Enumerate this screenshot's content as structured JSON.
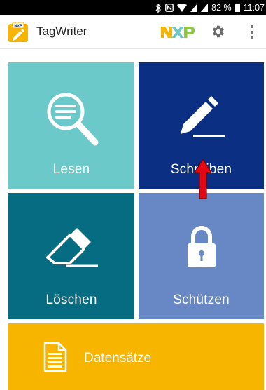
{
  "status_bar": {
    "battery_percent": "82 %",
    "time": "11:07",
    "icons": [
      "bluetooth-icon",
      "nfc-icon",
      "wifi-icon",
      "signal-icon",
      "signal-icon",
      "battery-icon"
    ]
  },
  "app_bar": {
    "title": "TagWriter",
    "logo_text": "NXP",
    "brand_logo": "nxp-logo",
    "actions": [
      "settings-gear-icon",
      "overflow-menu-icon"
    ]
  },
  "tiles": {
    "read": {
      "label": "Lesen",
      "icon": "magnifier-icon",
      "color": "#6cc9ca"
    },
    "write": {
      "label": "Schreiben",
      "icon": "pencil-icon",
      "color": "#0b2f82"
    },
    "erase": {
      "label": "Löschen",
      "icon": "eraser-icon",
      "color": "#066c82"
    },
    "protect": {
      "label": "Schützen",
      "icon": "lock-icon",
      "color": "#6788c4"
    },
    "records": {
      "label": "Datensätze",
      "icon": "document-icon",
      "color": "#f7b500"
    }
  },
  "annotation": {
    "icon": "red-up-arrow-icon",
    "color": "#e30613"
  }
}
